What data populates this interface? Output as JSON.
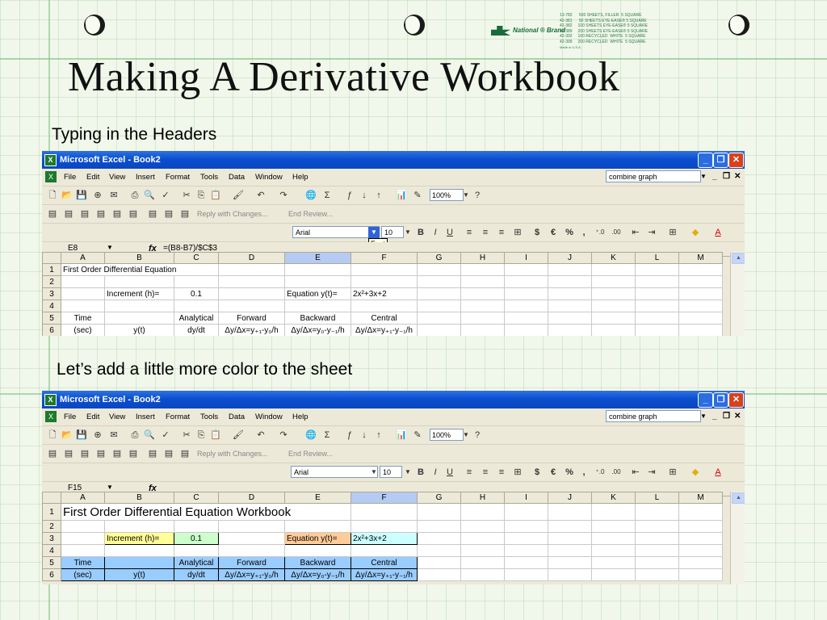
{
  "slide": {
    "title": "Making A Derivative Workbook",
    "caption1": "Typing in the Headers",
    "caption2": "Let’s add a little more color to the sheet",
    "brand": {
      "logo_text": "National ® Brand",
      "lines": [
        "13-782      500 SHEETS, FILLER  5 SQUARE",
        "42-381      50 SHEETS EYE-EASE® 5 SQUARE",
        "42-382     100 SHEETS EYE-EASE® 5 SQUARE",
        "42-389     200 SHEETS EYE-EASE® 5 SQUARE",
        "42-392     100 RECYCLED  WHITE  5 SQUARE",
        "42-399     200 RECYCLED  WHITE  5 SQUARE"
      ],
      "made_in": "Made in U.S.A."
    }
  },
  "excel": {
    "window_title": "Microsoft Excel - Book2",
    "menu": [
      "File",
      "Edit",
      "View",
      "Insert",
      "Format",
      "Tools",
      "Data",
      "Window",
      "Help"
    ],
    "help_box": "combine graph",
    "zoom": "100%",
    "reply_text": "Reply with Changes...",
    "end_review": "End Review...",
    "font_name": "Arial",
    "font_size": "10",
    "font_tooltip": "Font",
    "columns": [
      "A",
      "B",
      "C",
      "D",
      "E",
      "F",
      "G",
      "H",
      "I",
      "J",
      "K",
      "L",
      "M"
    ],
    "rows": [
      "1",
      "2",
      "3",
      "4",
      "5",
      "6"
    ]
  },
  "sheet1": {
    "name_box": "E8",
    "formula": "=(B8-B7)/$C$3",
    "a1": "First Order Differential Equation",
    "b3": "Increment (h)=",
    "c3": "0.1",
    "e3": "Equation y(t)=",
    "f3": "2x²+3x+2",
    "a5": "Time",
    "c5": "Analytical",
    "d5": "Forward",
    "e5": "Backward",
    "f5": "Central",
    "a6": "(sec)",
    "b6": "y(t)",
    "c6": "dy/dt",
    "d6": "Δy/Δx=y₊₁-y₀/h",
    "e6": "Δy/Δx=y₀-y₋₁/h",
    "f6": "Δy/Δx=y₊₁-y₋₁/h"
  },
  "sheet2": {
    "name_box": "F15",
    "formula": "",
    "a1": "First Order Differential Equation Workbook",
    "b3": "Increment (h)=",
    "c3": "0.1",
    "e3": "Equation y(t)=",
    "f3": "2x²+3x+2",
    "a5": "Time",
    "c5": "Analytical",
    "d5": "Forward",
    "e5": "Backward",
    "f5": "Central",
    "a6": "(sec)",
    "b6": "y(t)",
    "c6": "dy/dt",
    "d6": "Δy/Δx=y₊₁-y₀/h",
    "e6": "Δy/Δx=y₀-y₋₁/h",
    "f6": "Δy/Δx=y₊₁-y₋₁/h"
  },
  "colors": {
    "label_fill": "#ffff99",
    "value_fill": "#ccffcc",
    "equation_fill": "#ffcc99",
    "formula_fill": "#ccffff",
    "header_fill": "#99ccff"
  }
}
